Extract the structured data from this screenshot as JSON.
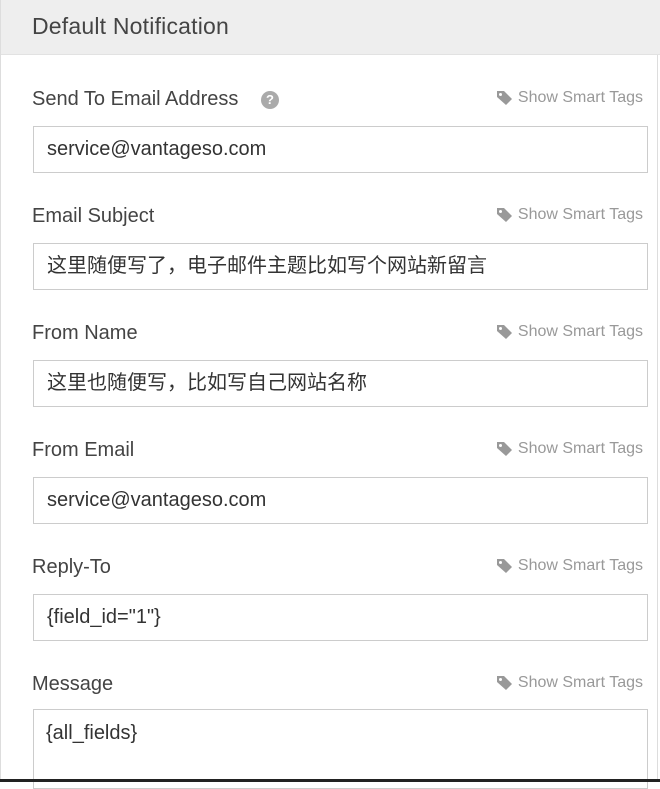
{
  "panel": {
    "title": "Default Notification"
  },
  "smart_tags_label": "Show Smart Tags",
  "fields": [
    {
      "label": "Send To Email Address",
      "value": "service@vantageso.com",
      "has_help": true,
      "help_glyph": "?"
    },
    {
      "label": "Email Subject",
      "value": "这里随便写了，电子邮件主题比如写个网站新留言"
    },
    {
      "label": "From Name",
      "value": "这里也随便写，比如写自己网站名称"
    },
    {
      "label": "From Email",
      "value": "service@vantageso.com"
    },
    {
      "label": "Reply-To",
      "value": "{field_id=\"1\"}"
    },
    {
      "label": "Message",
      "value": "{all_fields}"
    }
  ],
  "icons": {
    "help": "question-circle-icon",
    "tag": "tag-icon"
  },
  "colors": {
    "header_bg": "#eeeeee",
    "muted": "#999999",
    "border": "#cccccc",
    "text": "#444444"
  }
}
